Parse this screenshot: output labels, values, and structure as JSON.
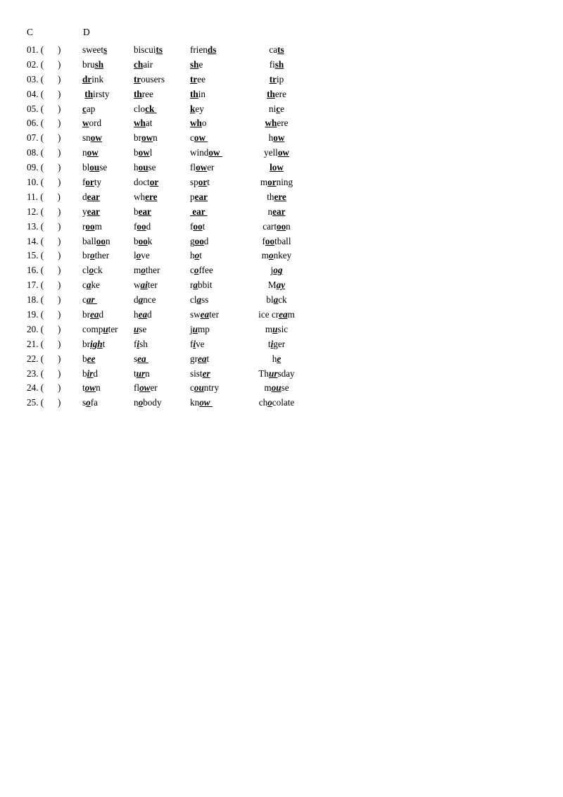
{
  "page": {
    "headers": {
      "left": "C",
      "right": "D"
    },
    "bracket_open": "(",
    "bracket_close": ")",
    "number_suffix": ".",
    "marker_style_plain": "bold-underline",
    "marker_style_italic": "bold-italic-underline",
    "text_color": "#000000",
    "background_color": "#ffffff"
  },
  "rows": [
    {
      "n": "01.",
      "style": "plain",
      "words": [
        {
          "pre": "sweet",
          "mark": "s",
          "post": ""
        },
        {
          "pre": "biscui",
          "mark": "ts",
          "post": ""
        },
        {
          "pre": "frien",
          "mark": "ds",
          "post": ""
        },
        {
          "pre": "ca",
          "mark": "ts",
          "post": ""
        }
      ]
    },
    {
      "n": "02.",
      "style": "plain",
      "words": [
        {
          "pre": "bru",
          "mark": "sh",
          "post": ""
        },
        {
          "pre": "",
          "mark": "ch",
          "post": "air"
        },
        {
          "pre": "",
          "mark": "sh",
          "post": "e"
        },
        {
          "pre": "fi",
          "mark": "sh",
          "post": ""
        }
      ]
    },
    {
      "n": "03.",
      "style": "plain",
      "words": [
        {
          "pre": "",
          "mark": "dr",
          "post": "ink"
        },
        {
          "pre": "",
          "mark": "tr",
          "post": "ousers"
        },
        {
          "pre": "",
          "mark": "tr",
          "post": "ee"
        },
        {
          "pre": "",
          "mark": "tr",
          "post": "ip"
        }
      ]
    },
    {
      "n": "04.",
      "style": "plain",
      "words": [
        {
          "pre": " ",
          "mark": "th",
          "post": "irsty"
        },
        {
          "pre": "",
          "mark": "th",
          "post": "ree"
        },
        {
          "pre": "",
          "mark": "th",
          "post": "in"
        },
        {
          "pre": "",
          "mark": "th",
          "post": "ere"
        }
      ]
    },
    {
      "n": "05.",
      "style": "plain",
      "words": [
        {
          "pre": "",
          "mark": "c",
          "post": "ap"
        },
        {
          "pre": "clo",
          "mark": "ck ",
          "post": ""
        },
        {
          "pre": "",
          "mark": "k",
          "post": "ey"
        },
        {
          "pre": "ni",
          "mark": "c",
          "post": "e"
        }
      ]
    },
    {
      "n": "06.",
      "style": "plain",
      "words": [
        {
          "pre": "",
          "mark": "w",
          "post": "ord"
        },
        {
          "pre": "",
          "mark": "wh",
          "post": "at"
        },
        {
          "pre": "",
          "mark": "wh",
          "post": "o"
        },
        {
          "pre": "",
          "mark": "wh",
          "post": "ere"
        }
      ]
    },
    {
      "n": "07.",
      "style": "plain",
      "words": [
        {
          "pre": "sn",
          "mark": "ow",
          "post": ""
        },
        {
          "pre": "br",
          "mark": "ow",
          "post": "n"
        },
        {
          "pre": "c",
          "mark": "ow ",
          "post": ""
        },
        {
          "pre": "h",
          "mark": "ow",
          "post": ""
        }
      ]
    },
    {
      "n": "08.",
      "style": "plain",
      "words": [
        {
          "pre": "n",
          "mark": "ow",
          "post": ""
        },
        {
          "pre": "b",
          "mark": "ow",
          "post": "l"
        },
        {
          "pre": "wind",
          "mark": "ow ",
          "post": ""
        },
        {
          "pre": "yell",
          "mark": "ow",
          "post": ""
        }
      ]
    },
    {
      "n": "09.",
      "style": "plain",
      "words": [
        {
          "pre": "bl",
          "mark": "ou",
          "post": "se"
        },
        {
          "pre": "h",
          "mark": "ou",
          "post": "se"
        },
        {
          "pre": "fl",
          "mark": "ow",
          "post": "er"
        },
        {
          "pre": "",
          "mark": "low",
          "post": ""
        }
      ]
    },
    {
      "n": "10.",
      "style": "plain",
      "words": [
        {
          "pre": "f",
          "mark": "or",
          "post": "ty"
        },
        {
          "pre": "doct",
          "mark": "or",
          "post": ""
        },
        {
          "pre": "sp",
          "mark": "or",
          "post": "t"
        },
        {
          "pre": "m",
          "mark": "or",
          "post": "ning"
        }
      ]
    },
    {
      "n": "11.",
      "style": "plain",
      "words": [
        {
          "pre": "d",
          "mark": "ear",
          "post": ""
        },
        {
          "pre": "wh",
          "mark": "ere",
          "post": ""
        },
        {
          "pre": "p",
          "mark": "ear",
          "post": ""
        },
        {
          "pre": "th",
          "mark": "ere",
          "post": ""
        }
      ]
    },
    {
      "n": "12.",
      "style": "plain",
      "words": [
        {
          "pre": "y",
          "mark": "ear",
          "post": ""
        },
        {
          "pre": "b",
          "mark": "ear",
          "post": ""
        },
        {
          "pre": "",
          "mark": " ear ",
          "post": ""
        },
        {
          "pre": "n",
          "mark": "ear",
          "post": ""
        }
      ]
    },
    {
      "n": "13.",
      "style": "plain",
      "words": [
        {
          "pre": "r",
          "mark": "oo",
          "post": "m"
        },
        {
          "pre": "f",
          "mark": "oo",
          "post": "d"
        },
        {
          "pre": "f",
          "mark": "oo",
          "post": "t"
        },
        {
          "pre": "cart",
          "mark": "oo",
          "post": "n"
        }
      ]
    },
    {
      "n": "14.",
      "style": "plain",
      "words": [
        {
          "pre": "ball",
          "mark": "oo",
          "post": "n"
        },
        {
          "pre": "b",
          "mark": "oo",
          "post": "k"
        },
        {
          "pre": "g",
          "mark": "oo",
          "post": "d"
        },
        {
          "pre": "f",
          "mark": "oo",
          "post": "tball"
        }
      ]
    },
    {
      "n": "15.",
      "style": "italic",
      "words": [
        {
          "pre": "br",
          "mark": "o",
          "post": "ther"
        },
        {
          "pre": "l",
          "mark": "o",
          "post": "ve"
        },
        {
          "pre": "h",
          "mark": "o",
          "post": "t"
        },
        {
          "pre": "m",
          "mark": "o",
          "post": "nkey"
        }
      ]
    },
    {
      "n": "16.",
      "style": "italic",
      "words": [
        {
          "pre": "cl",
          "mark": "o",
          "post": "ck"
        },
        {
          "pre": "m",
          "mark": "o",
          "post": "ther"
        },
        {
          "pre": "c",
          "mark": "o",
          "post": "ffee"
        },
        {
          "pre": "j",
          "mark": "og",
          "post": ""
        }
      ]
    },
    {
      "n": "17.",
      "style": "italic",
      "words": [
        {
          "pre": "c",
          "mark": "a",
          "post": "ke"
        },
        {
          "pre": "w",
          "mark": "ai",
          "post": "ter"
        },
        {
          "pre": "r",
          "mark": "a",
          "post": "bbit"
        },
        {
          "pre": "M",
          "mark": "ay",
          "post": ""
        }
      ]
    },
    {
      "n": "18.",
      "style": "italic",
      "words": [
        {
          "pre": "c",
          "mark": "ar ",
          "post": ""
        },
        {
          "pre": "d",
          "mark": "a",
          "post": "nce"
        },
        {
          "pre": "cl",
          "mark": "a",
          "post": "ss"
        },
        {
          "pre": "bl",
          "mark": "a",
          "post": "ck"
        }
      ]
    },
    {
      "n": "19.",
      "style": "italic",
      "words": [
        {
          "pre": "br",
          "mark": "ea",
          "post": "d"
        },
        {
          "pre": "h",
          "mark": "ea",
          "post": "d"
        },
        {
          "pre": "sw",
          "mark": "ea",
          "post": "ter"
        },
        {
          "pre": "ice cr",
          "mark": "ea",
          "post": "m"
        }
      ]
    },
    {
      "n": "20.",
      "style": "italic",
      "words": [
        {
          "pre": "comp",
          "mark": "u",
          "post": "ter"
        },
        {
          "pre": "",
          "mark": "u",
          "post": "se"
        },
        {
          "pre": "j",
          "mark": "u",
          "post": "mp"
        },
        {
          "pre": "m",
          "mark": "u",
          "post": "sic"
        }
      ]
    },
    {
      "n": "21.",
      "style": "italic",
      "words": [
        {
          "pre": "br",
          "mark": "igh",
          "post": "t"
        },
        {
          "pre": "f",
          "mark": "i",
          "post": "sh"
        },
        {
          "pre": "f",
          "mark": "i",
          "post": "ve"
        },
        {
          "pre": "t",
          "mark": "i",
          "post": "ger"
        }
      ]
    },
    {
      "n": "22.",
      "style": "italic",
      "words": [
        {
          "pre": "b",
          "mark": "ee",
          "post": ""
        },
        {
          "pre": "s",
          "mark": "ea ",
          "post": ""
        },
        {
          "pre": "gr",
          "mark": "ea",
          "post": "t"
        },
        {
          "pre": "h",
          "mark": "e",
          "post": ""
        }
      ]
    },
    {
      "n": "23.",
      "style": "italic",
      "words": [
        {
          "pre": "b",
          "mark": "ir",
          "post": "d"
        },
        {
          "pre": "t",
          "mark": "ur",
          "post": "n"
        },
        {
          "pre": "sist",
          "mark": "er",
          "post": ""
        },
        {
          "pre": "Th",
          "mark": "ur",
          "post": "sday"
        }
      ]
    },
    {
      "n": "24.",
      "style": "italic",
      "words": [
        {
          "pre": "t",
          "mark": "ow",
          "post": "n"
        },
        {
          "pre": "fl",
          "mark": "ow",
          "post": "er"
        },
        {
          "pre": "c",
          "mark": "ou",
          "post": "ntry"
        },
        {
          "pre": "m",
          "mark": "ou",
          "post": "se"
        }
      ]
    },
    {
      "n": "25.",
      "style": "italic",
      "words": [
        {
          "pre": "s",
          "mark": "o",
          "post": "fa"
        },
        {
          "pre": "n",
          "mark": "o",
          "post": "body"
        },
        {
          "pre": "kn",
          "mark": "ow ",
          "post": ""
        },
        {
          "pre": "ch",
          "mark": "o",
          "post": "colate"
        }
      ]
    }
  ]
}
